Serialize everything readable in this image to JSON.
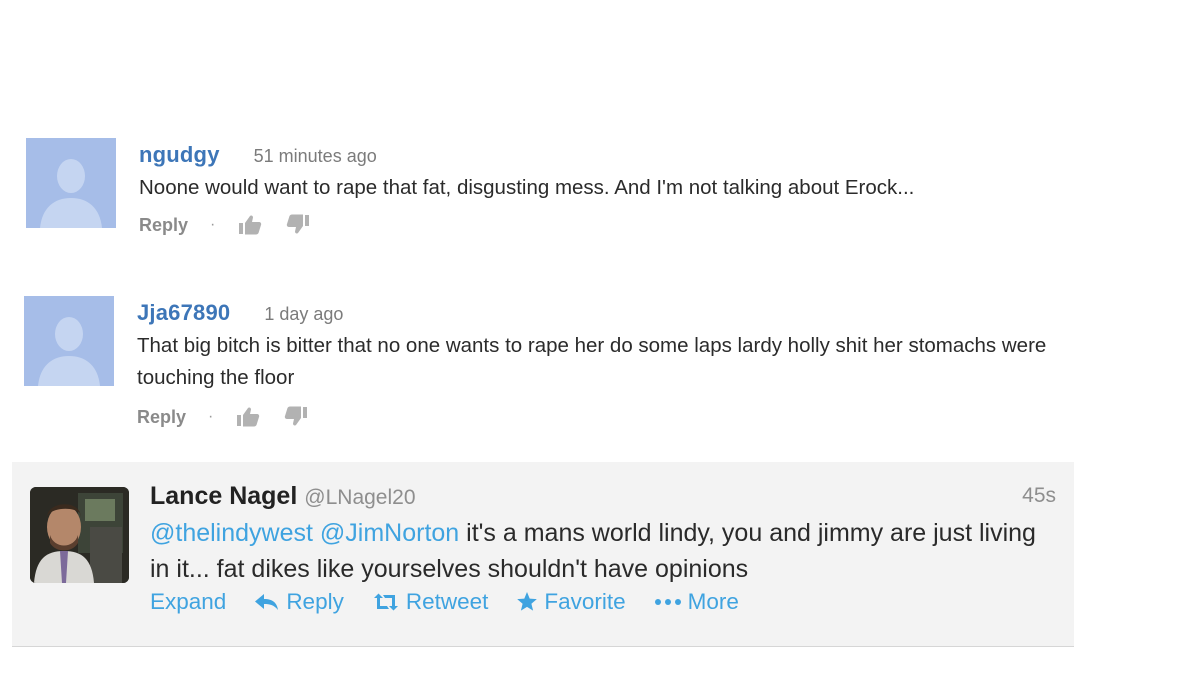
{
  "comments": [
    {
      "username": "ngudgy",
      "time": "51 minutes ago",
      "text": "Noone would want to rape that fat, disgusting mess. And I'm not talking about Erock...",
      "reply_label": "Reply",
      "separator": "·"
    },
    {
      "username": "Jja67890",
      "time": "1 day ago",
      "text": "That big bitch is bitter that no one wants to rape her do some laps lardy holly shit her stomachs were touching the floor",
      "reply_label": "Reply",
      "separator": "·"
    }
  ],
  "tweet": {
    "name": "Lance Nagel",
    "handle": "@LNagel20",
    "time": "45s",
    "mention1": "@thelindywest",
    "mention2": "@JimNorton",
    "text": " it's a mans world lindy, you and jimmy are just living in it...  fat dikes like yourselves shouldn't have opinions",
    "actions": {
      "expand": "Expand",
      "reply": "Reply",
      "retweet": "Retweet",
      "favorite": "Favorite",
      "more": "More"
    }
  },
  "icons": {
    "default_avatar": "default-avatar-silhouette",
    "thumbs_up": "thumbs-up-icon",
    "thumbs_down": "thumbs-down-icon",
    "reply": "reply-arrow-icon",
    "retweet": "retweet-icon",
    "favorite": "star-icon",
    "more": "ellipsis-icon"
  },
  "colors": {
    "username_link": "#3d76b8",
    "twitter_link": "#3fa3e0",
    "avatar_placeholder": "#a6bde8",
    "tweet_background": "#f3f3f3"
  }
}
